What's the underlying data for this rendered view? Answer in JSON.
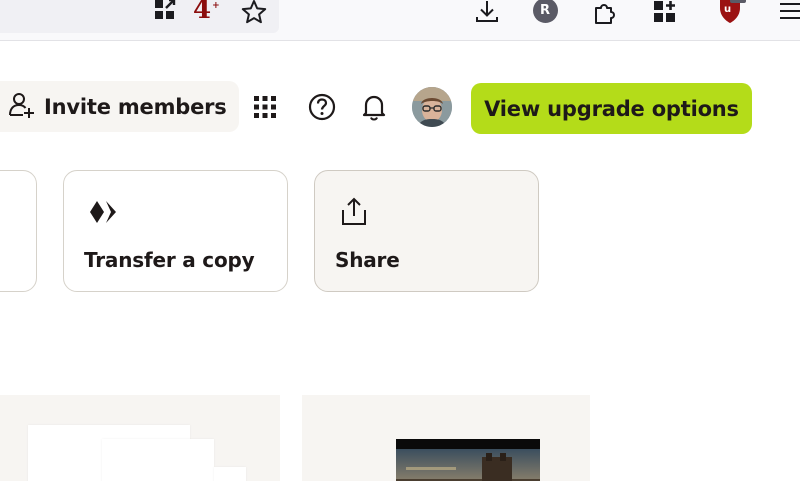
{
  "browser": {
    "extension_badge": "4",
    "extension_badge_suffix": "+",
    "profile_initial": "R"
  },
  "header": {
    "invite_label": "Invite members",
    "upgrade_label": "View upgrade options",
    "upgrade_color": "#b4dc19"
  },
  "cards": [
    {
      "label": "Transfer a copy",
      "icon": "transfer-icon"
    },
    {
      "label": "Share",
      "icon": "share-icon"
    }
  ],
  "colors": {
    "card_border": "#d6d2ca",
    "surface": "#f7f5f2",
    "text": "#1e1919"
  }
}
